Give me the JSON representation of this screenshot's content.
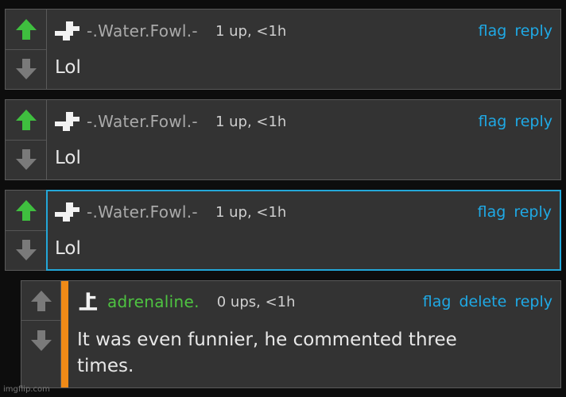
{
  "colors": {
    "background": "#0d0d0d",
    "card": "#333333",
    "upvote_active": "#3fbf3f",
    "vote_inactive": "#7a7a7a",
    "link": "#1fa9e5",
    "selected_border": "#23a7d8",
    "accent": "#f08a17",
    "username_default": "#aaaaaa",
    "username_self": "#4ec341"
  },
  "comments": [
    {
      "username": "-.Water.Fowl.-",
      "meta": "1 up, <1h",
      "text": "Lol",
      "upvoted": true,
      "avatar_icon": "pixel-puzzle-avatar-icon",
      "actions": [
        "flag",
        "reply"
      ]
    },
    {
      "username": "-.Water.Fowl.-",
      "meta": "1 up, <1h",
      "text": "Lol",
      "upvoted": true,
      "avatar_icon": "pixel-puzzle-avatar-icon",
      "actions": [
        "flag",
        "reply"
      ]
    },
    {
      "username": "-.Water.Fowl.-",
      "meta": "1 up, <1h",
      "text": "Lol",
      "upvoted": true,
      "selected": true,
      "avatar_icon": "pixel-puzzle-avatar-icon",
      "actions": [
        "flag",
        "reply"
      ]
    },
    {
      "username": "adrenaline.",
      "meta": "0 ups, <1h",
      "text": "It was even funnier, he commented three times.",
      "upvoted": false,
      "own_comment": true,
      "avatar_icon": "pixel-cross-avatar-icon",
      "actions": [
        "flag",
        "delete",
        "reply"
      ]
    }
  ],
  "watermark": "imgflip.com"
}
